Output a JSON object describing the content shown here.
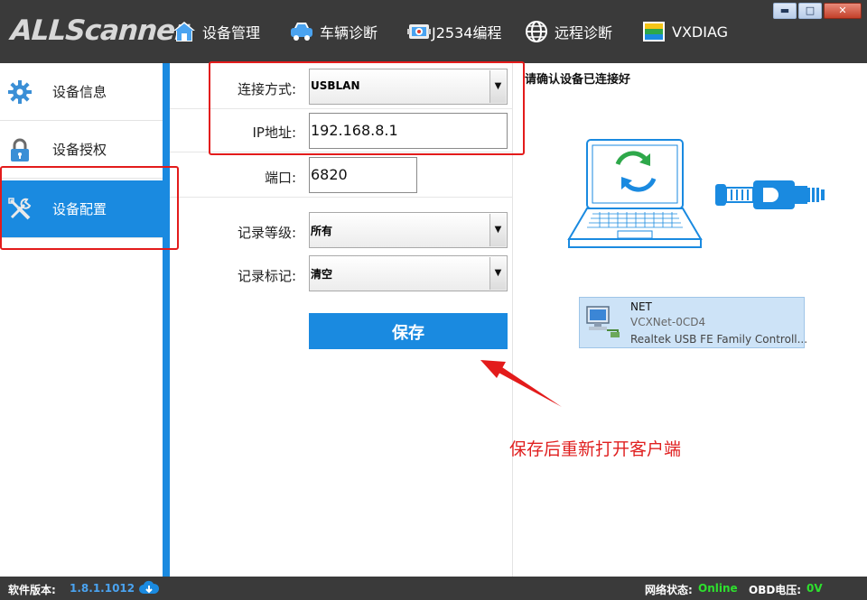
{
  "app": {
    "logo_text": "ALLScanner"
  },
  "nav": {
    "items": [
      {
        "label": "设备管理",
        "icon": "home-icon"
      },
      {
        "label": "车辆诊断",
        "icon": "car-icon"
      },
      {
        "label": "J2534编程",
        "icon": "engine-icon"
      },
      {
        "label": "远程诊断",
        "icon": "globe-icon"
      },
      {
        "label": "VXDIAG",
        "icon": "vxdiag-icon"
      }
    ]
  },
  "window": {
    "minimize": "▬",
    "maximize": "□",
    "close": "✕"
  },
  "sidebar": {
    "items": [
      {
        "label": "设备信息",
        "icon": "gear-icon",
        "active": false
      },
      {
        "label": "设备授权",
        "icon": "lock-icon",
        "active": false
      },
      {
        "label": "设备配置",
        "icon": "tools-icon",
        "active": true
      }
    ]
  },
  "form": {
    "connection": {
      "label": "连接方式:",
      "value": "USBLAN"
    },
    "ip": {
      "label": "IP地址:",
      "value": "192.168.8.1"
    },
    "port": {
      "label": "端口:",
      "value": "6820"
    },
    "log_level": {
      "label": "记录等级:",
      "value": "所有"
    },
    "log_flag": {
      "label": "记录标记:",
      "value": "清空"
    },
    "save_label": "保存"
  },
  "right_panel": {
    "title": "请确认设备已连接好",
    "network": {
      "name": "NET",
      "adapter": "VCXNet-0CD4",
      "description": "Realtek USB FE Family Controll..."
    },
    "annotation": "保存后重新打开客户端"
  },
  "statusbar": {
    "version_label": "软件版本:",
    "version_value": "1.8.1.1012",
    "network_label": "网络状态:",
    "network_value": "Online",
    "obd_label": "OBD电压:",
    "obd_value": "0V"
  },
  "colors": {
    "accent": "#1a8ae0",
    "topbar": "#3a3a3a",
    "annotation": "#e31b1b",
    "version": "#4aa3f0",
    "status_ok": "#2ee02e"
  }
}
